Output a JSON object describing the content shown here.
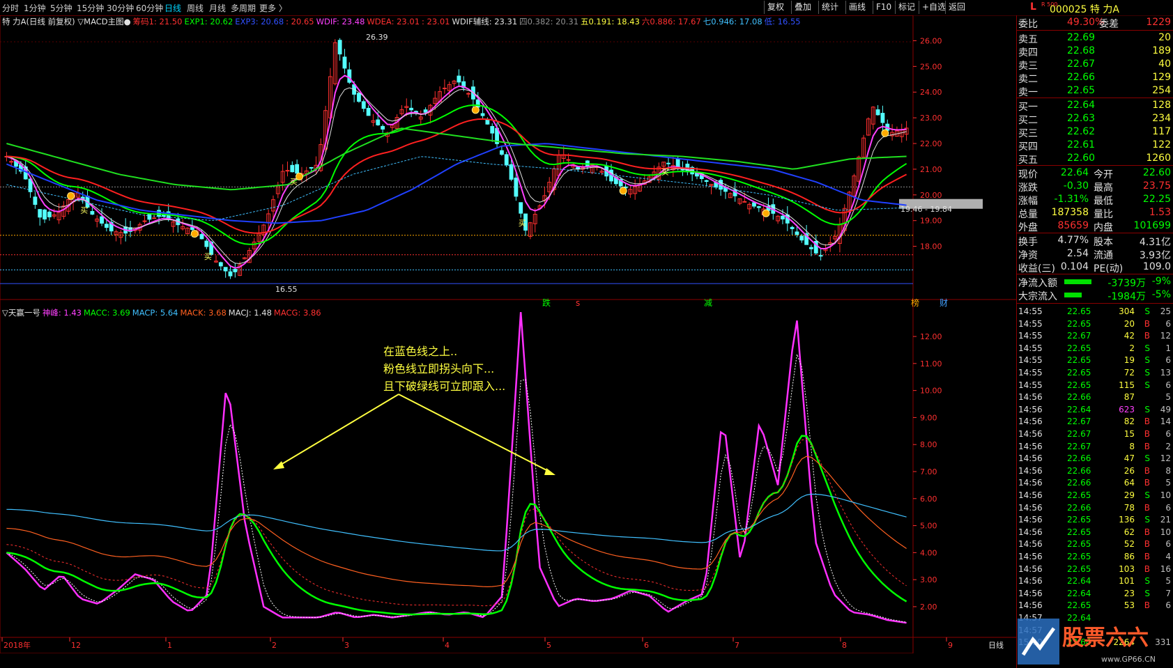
{
  "periods": [
    "分时",
    "1分钟",
    "5分钟",
    "15分钟",
    "30分钟",
    "60分钟",
    "日线",
    "周线",
    "月线",
    "多周期",
    "更多 〉"
  ],
  "active_period": "日线",
  "toolbar_buttons": [
    "复权",
    "叠加",
    "统计",
    "画线",
    "F10",
    "标记",
    "+自选",
    "返回"
  ],
  "symbol": {
    "prefix": "L",
    "index": "R 500",
    "code": "000025 特 力A"
  },
  "main_legend": [
    {
      "text": "特 力A(日线 前复权) ▽MACD主图●",
      "color": "#e0e0e0"
    },
    {
      "text": "筹码1: 21.50",
      "color": "#ff3030"
    },
    {
      "text": "EXP1: 20.62",
      "color": "#00ff00"
    },
    {
      "text": "EXP3: 20.68",
      "color": "#3050ff"
    },
    {
      "text": ": 20.65",
      "color": "#ff3030"
    },
    {
      "text": "WDIF: 23.48",
      "color": "#ff40ff"
    },
    {
      "text": "WDEA: 23.01",
      "color": "#ff3030"
    },
    {
      "text": ": 23.01",
      "color": "#ff3030"
    },
    {
      "text": "WDIF辅线: 23.31",
      "color": "#e0e0e0"
    },
    {
      "text": "四0.382: 20.31",
      "color": "#909090"
    },
    {
      "text": "五0.191: 18.43",
      "color": "#ffff40"
    },
    {
      "text": "六0.886: 17.67",
      "color": "#ff3030"
    },
    {
      "text": "七0.946: 17.08",
      "color": "#40c0ff"
    },
    {
      "text": "低: 16.55",
      "color": "#3050ff"
    }
  ],
  "price_axis": [
    "26.00",
    "25.00",
    "24.00",
    "23.00",
    "22.00",
    "21.00",
    "20.00",
    "19.00",
    "18.00"
  ],
  "price_labels": {
    "high": "26.39",
    "low": "16.55",
    "range": "19.46 - 19.84"
  },
  "signal_marks": [
    {
      "text": "跌",
      "color": "#00ff00"
    },
    {
      "text": "s",
      "color": "#ff3030"
    },
    {
      "text": "减",
      "color": "#00ff00"
    },
    {
      "text": "榜",
      "color": "#ffaa00"
    },
    {
      "text": "财",
      "color": "#40a0ff"
    }
  ],
  "buy_marker_text": "买",
  "sub_legend": [
    {
      "text": "▽天赢一号",
      "color": "#e0e0e0"
    },
    {
      "text": "神峰: 1.43",
      "color": "#ff40ff"
    },
    {
      "text": "MACC: 3.69",
      "color": "#00ff00"
    },
    {
      "text": "MACP: 5.64",
      "color": "#40c0ff"
    },
    {
      "text": "MACK: 3.68",
      "color": "#ff6020"
    },
    {
      "text": "MACJ: 1.48",
      "color": "#e0e0e0"
    },
    {
      "text": "MACG: 3.86",
      "color": "#ff3030"
    }
  ],
  "sub_axis": [
    "12.00",
    "11.00",
    "10.00",
    "9.00",
    "8.00",
    "7.00",
    "6.00",
    "5.00",
    "4.00",
    "3.00",
    "2.00"
  ],
  "date_axis": [
    "2018年",
    "12",
    "1",
    "2",
    "3",
    "4",
    "5",
    "6",
    "7",
    "8",
    "9"
  ],
  "date_axis_right": "日线",
  "annotation": [
    "在蓝色线之上..",
    "粉色线立即拐头向下...",
    "且下破绿线可立即跟入..."
  ],
  "quote": {
    "weibi": {
      "label": "委比",
      "value": "49.30%",
      "label2": "委差",
      "value2": "1229"
    },
    "sells": [
      {
        "label": "卖五",
        "price": "22.69",
        "vol": "20"
      },
      {
        "label": "卖四",
        "price": "22.68",
        "vol": "189"
      },
      {
        "label": "卖三",
        "price": "22.67",
        "vol": "40"
      },
      {
        "label": "卖二",
        "price": "22.66",
        "vol": "129"
      },
      {
        "label": "卖一",
        "price": "22.65",
        "vol": "254"
      }
    ],
    "buys": [
      {
        "label": "买一",
        "price": "22.64",
        "vol": "128"
      },
      {
        "label": "买二",
        "price": "22.63",
        "vol": "234"
      },
      {
        "label": "买三",
        "price": "22.62",
        "vol": "117"
      },
      {
        "label": "买四",
        "price": "22.61",
        "vol": "122"
      },
      {
        "label": "买五",
        "price": "22.60",
        "vol": "1260"
      }
    ],
    "stats": [
      {
        "l1": "现价",
        "v1": "22.64",
        "c1": "#00ff00",
        "l2": "今开",
        "v2": "22.60",
        "c2": "#00ff00"
      },
      {
        "l1": "涨跌",
        "v1": "-0.30",
        "c1": "#00ff00",
        "l2": "最高",
        "v2": "23.75",
        "c2": "#ff3030"
      },
      {
        "l1": "涨幅",
        "v1": "-1.31%",
        "c1": "#00ff00",
        "l2": "最低",
        "v2": "22.25",
        "c2": "#00ff00"
      },
      {
        "l1": "总量",
        "v1": "187358",
        "c1": "#ffff40",
        "l2": "量比",
        "v2": "1.53",
        "c2": "#ff3030"
      },
      {
        "l1": "外盘",
        "v1": "85659",
        "c1": "#ff3030",
        "l2": "内盘",
        "v2": "101699",
        "c2": "#00ff00"
      }
    ],
    "stats2": [
      {
        "l1": "换手",
        "v1": "4.77%",
        "l2": "股本",
        "v2": "4.31亿"
      },
      {
        "l1": "净资",
        "v1": "2.54",
        "l2": "流通",
        "v2": "3.93亿"
      },
      {
        "l1": "收益(三)",
        "v1": "0.104",
        "l2": "PE(动)",
        "v2": "109.0"
      }
    ],
    "flows": [
      {
        "label": "净流入额",
        "value": "-3739万",
        "pct": "-9%",
        "bar": 0.55
      },
      {
        "label": "大宗流入",
        "value": "-1984万",
        "pct": "-5%",
        "bar": 0.35
      }
    ]
  },
  "ticks": [
    {
      "t": "14:55",
      "p": "22.65",
      "v": "304",
      "bs": "S",
      "n": "25"
    },
    {
      "t": "14:55",
      "p": "22.65",
      "v": "20",
      "bs": "B",
      "n": "6"
    },
    {
      "t": "14:55",
      "p": "22.67",
      "v": "42",
      "bs": "B",
      "n": "12"
    },
    {
      "t": "14:55",
      "p": "22.65",
      "v": "2",
      "bs": "S",
      "n": "1"
    },
    {
      "t": "14:55",
      "p": "22.65",
      "v": "19",
      "bs": "S",
      "n": "6"
    },
    {
      "t": "14:55",
      "p": "22.65",
      "v": "72",
      "bs": "S",
      "n": "13"
    },
    {
      "t": "14:55",
      "p": "22.65",
      "v": "115",
      "bs": "S",
      "n": "6"
    },
    {
      "t": "14:56",
      "p": "22.66",
      "v": "87",
      "bs": "",
      "n": "5"
    },
    {
      "t": "14:56",
      "p": "22.64",
      "v": "623",
      "bs": "S",
      "n": "49"
    },
    {
      "t": "14:56",
      "p": "22.67",
      "v": "82",
      "bs": "B",
      "n": "14"
    },
    {
      "t": "14:56",
      "p": "22.67",
      "v": "15",
      "bs": "B",
      "n": "6"
    },
    {
      "t": "14:56",
      "p": "22.67",
      "v": "8",
      "bs": "B",
      "n": "2"
    },
    {
      "t": "14:56",
      "p": "22.66",
      "v": "47",
      "bs": "S",
      "n": "12"
    },
    {
      "t": "14:56",
      "p": "22.66",
      "v": "26",
      "bs": "B",
      "n": "8"
    },
    {
      "t": "14:56",
      "p": "22.66",
      "v": "64",
      "bs": "B",
      "n": "5"
    },
    {
      "t": "14:56",
      "p": "22.65",
      "v": "29",
      "bs": "S",
      "n": "10"
    },
    {
      "t": "14:56",
      "p": "22.66",
      "v": "78",
      "bs": "B",
      "n": "6"
    },
    {
      "t": "14:56",
      "p": "22.65",
      "v": "136",
      "bs": "S",
      "n": "21"
    },
    {
      "t": "14:56",
      "p": "22.65",
      "v": "62",
      "bs": "B",
      "n": "10"
    },
    {
      "t": "14:56",
      "p": "22.65",
      "v": "52",
      "bs": "B",
      "n": "6"
    },
    {
      "t": "14:56",
      "p": "22.65",
      "v": "86",
      "bs": "B",
      "n": "4"
    },
    {
      "t": "14:56",
      "p": "22.65",
      "v": "103",
      "bs": "B",
      "n": "16"
    },
    {
      "t": "14:56",
      "p": "22.64",
      "v": "101",
      "bs": "S",
      "n": "5"
    },
    {
      "t": "14:56",
      "p": "22.64",
      "v": "23",
      "bs": "S",
      "n": "7"
    },
    {
      "t": "14:56",
      "p": "22.65",
      "v": "53",
      "bs": "B",
      "n": "6"
    },
    {
      "t": "14:57",
      "p": "22.64",
      "v": "",
      "bs": "",
      "n": ""
    },
    {
      "t": "14:57",
      "p": "",
      "v": "",
      "bs": "",
      "n": ""
    },
    {
      "t": "15:00",
      "p": "22.64",
      "v": "2264",
      "bs": "",
      "n": "331"
    }
  ],
  "watermark": {
    "main": "股票六六",
    "sub": "www.GP66.CN"
  }
}
